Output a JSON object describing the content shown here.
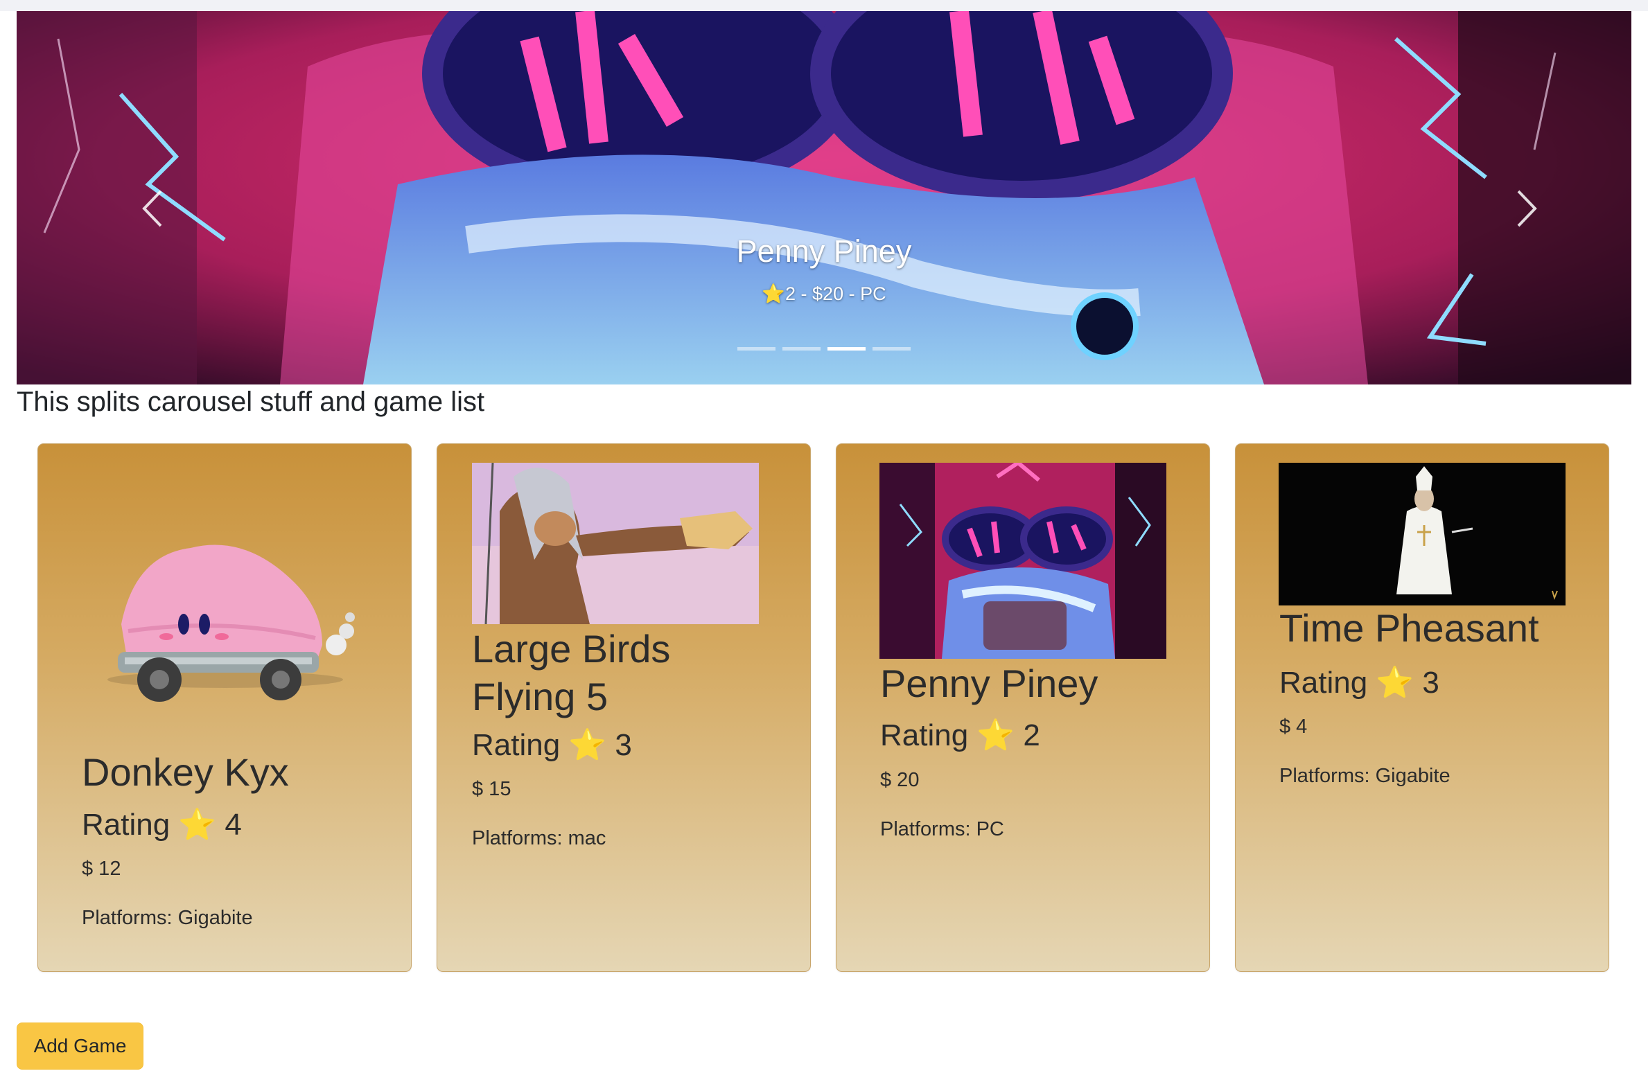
{
  "carousel": {
    "active_title": "Penny Piney",
    "active_subtitle": "⭐2 - $20 - PC",
    "indicator_count": 4,
    "active_indicator": 2
  },
  "split_text": "This splits carousel stuff and game list",
  "games": [
    {
      "title": "Donkey Kyx",
      "rating_label": "Rating ⭐ 4",
      "price": "$ 12",
      "platforms": "Platforms: Gigabite"
    },
    {
      "title": "Large Birds Flying 5",
      "rating_label": "Rating ⭐ 3",
      "price": "$ 15",
      "platforms": "Platforms: mac"
    },
    {
      "title": "Penny Piney",
      "rating_label": "Rating ⭐ 2",
      "price": "$ 20",
      "platforms": "Platforms: PC"
    },
    {
      "title": "Time Pheasant",
      "rating_label": "Rating ⭐ 3",
      "price": "$ 4",
      "platforms": "Platforms: Gigabite"
    }
  ],
  "add_button_label": "Add Game",
  "colors": {
    "button": "#f9c644",
    "card_top": "#c8913a",
    "card_bottom": "#e5d6b4"
  }
}
